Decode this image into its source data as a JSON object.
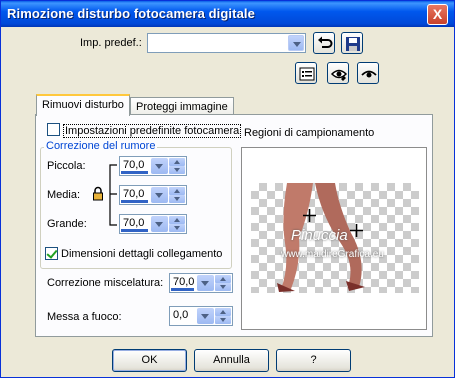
{
  "window": {
    "title": "Rimozione disturbo fotocamera digitale",
    "close_glyph": "X"
  },
  "preset": {
    "label": "Imp. predef.:",
    "value": ""
  },
  "tabs": [
    {
      "label": "Rimuovi disturbo"
    },
    {
      "label": "Proteggi immagine"
    }
  ],
  "default_settings_checkbox": {
    "label": "Impostazioni predefinite fotocamera",
    "checked": false
  },
  "noise_correction": {
    "title": "Correzione del rumore",
    "rows": [
      {
        "label": "Piccola:",
        "value": "70,0"
      },
      {
        "label": "Media:",
        "value": "70,0"
      },
      {
        "label": "Grande:",
        "value": "70,0"
      }
    ]
  },
  "link_details_checkbox": {
    "label": "Dimensioni dettagli collegamento",
    "checked": true
  },
  "blend_correction": {
    "label": "Correzione miscelatura:",
    "value": "70,0"
  },
  "sharpen": {
    "label": "Messa a fuoco:",
    "value": "0,0"
  },
  "sampling": {
    "label": "Regioni di campionamento"
  },
  "watermark": {
    "line1": "Pinuccia",
    "line2": "www.maidireGrafica.eu"
  },
  "buttons": {
    "ok": "OK",
    "cancel": "Annulla",
    "help": "?"
  },
  "colors": {
    "titlebar": "#0058EE",
    "accent": "#0046D5",
    "window_bg": "#ECE9D8"
  },
  "icons": [
    "close-icon",
    "undo-icon",
    "save-icon",
    "list-icon",
    "eye-icon",
    "eye-closed-icon",
    "lock-icon",
    "crosshair-icon"
  ]
}
